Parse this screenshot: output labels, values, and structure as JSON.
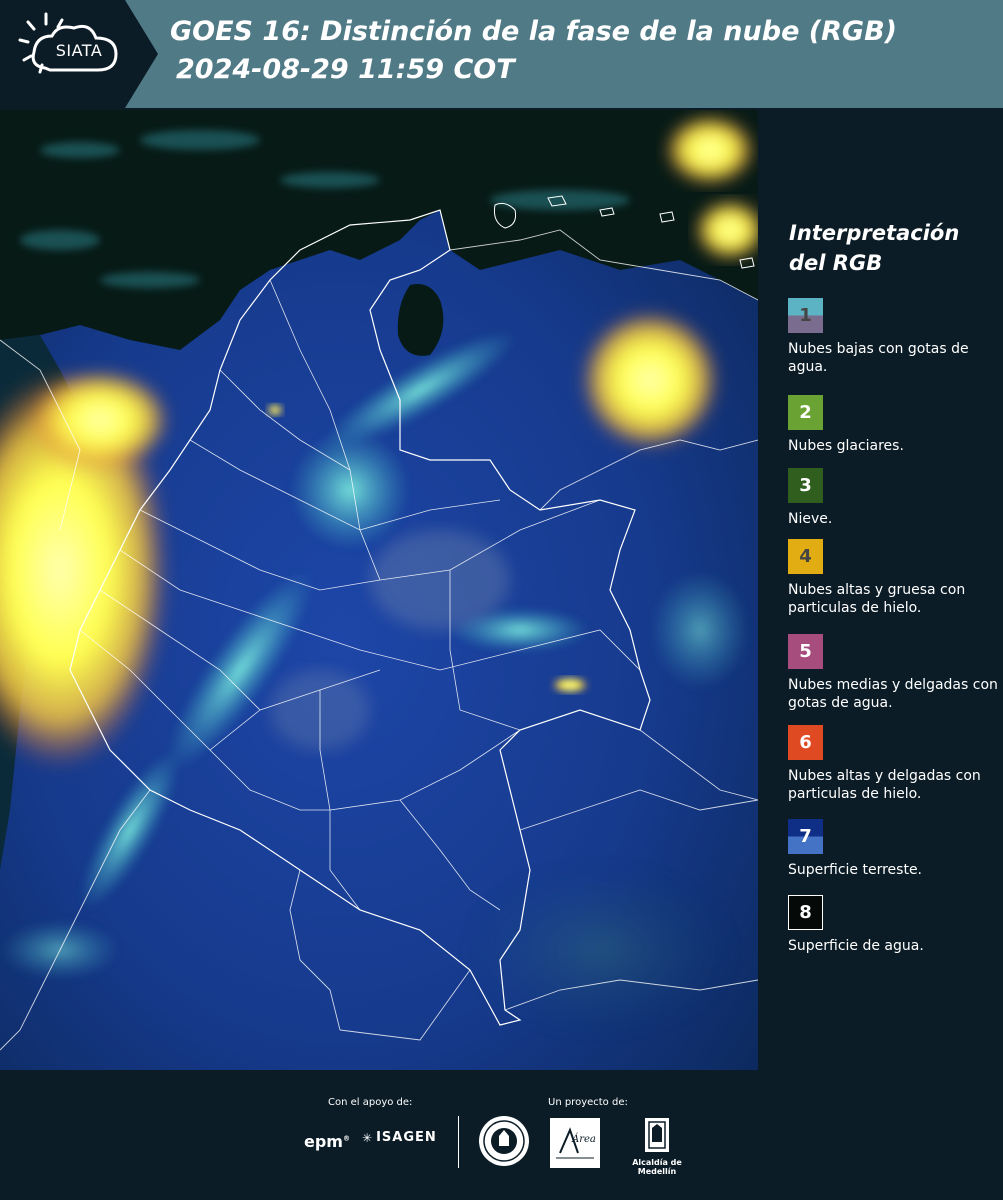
{
  "header": {
    "logo_text": "SIATA",
    "title": "GOES 16: Distinción de la fase de la nube (RGB)",
    "subtitle": "2024-08-29 11:59 COT"
  },
  "legend": {
    "title_line1": "Interpretación",
    "title_line2": "del RGB",
    "items": [
      {
        "num": "1",
        "text": "Nubes bajas con gotas de agua.",
        "color_top": "#5bb3c4",
        "color_bottom": "#7a6c8e",
        "num_color": "#444444"
      },
      {
        "num": "2",
        "text": "Nubes glaciares.",
        "color_top": "#6aa233",
        "color_bottom": "#6aa233",
        "num_color": "#ffffff"
      },
      {
        "num": "3",
        "text": "Nieve.",
        "color_top": "#2f5e1e",
        "color_bottom": "#2f5e1e",
        "num_color": "#ffffff"
      },
      {
        "num": "4",
        "text": "Nubes altas y gruesa con particulas de hielo.",
        "color_top": "#e2ad12",
        "color_bottom": "#e2ad12",
        "num_color": "#444444"
      },
      {
        "num": "5",
        "text": "Nubes medias y delgadas con gotas de agua.",
        "color_top": "#a64d7e",
        "color_bottom": "#a64d7e",
        "num_color": "#ffffff"
      },
      {
        "num": "6",
        "text": "Nubes altas y delgadas con particulas de hielo.",
        "color_top": "#e04a22",
        "color_bottom": "#e04a22",
        "num_color": "#ffffff"
      },
      {
        "num": "7",
        "text": "Superficie terreste.",
        "color_top": "#0f2f86",
        "color_bottom": "#4472c4",
        "num_color": "#ffffff"
      },
      {
        "num": "8",
        "text": "Superficie de agua.",
        "color_top": "#050a08",
        "color_bottom": "#050a08",
        "num_color": "#ffffff"
      }
    ]
  },
  "footer": {
    "support_label": "Con el apoyo de:",
    "project_label": "Un proyecto de:",
    "epm": "epm",
    "isagen": "ISAGEN",
    "area_logo_text": "Área",
    "alcaldia": "Alcaldía de Medellín"
  },
  "colors": {
    "header_bg": "#4f7a86",
    "page_bg": "#0b1c26",
    "land": "#0f2f86",
    "ocean": "#050a08",
    "ice_cloud": "#ffff66",
    "water_cloud": "#5ee0d8"
  }
}
